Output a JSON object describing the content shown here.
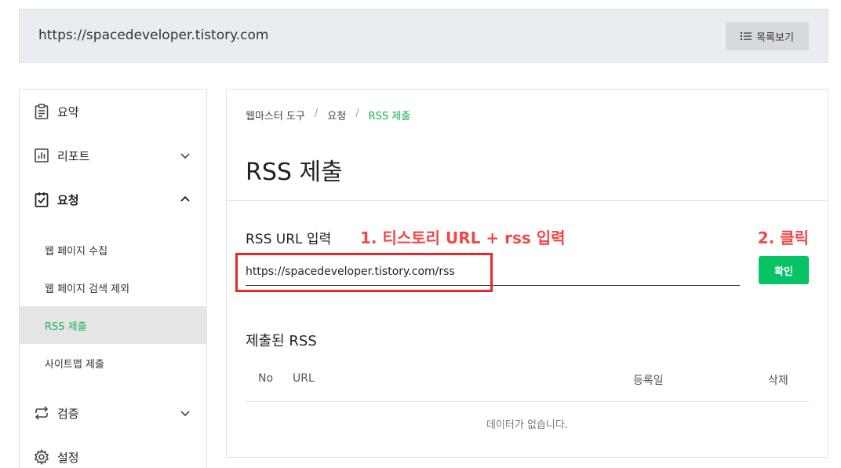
{
  "header": {
    "site_url": "https://spacedeveloper.tistory.com",
    "list_button_label": "목록보기",
    "list_button_icon": "list-icon"
  },
  "sidebar": {
    "items": [
      {
        "label": "요약",
        "icon": "clipboard-icon"
      },
      {
        "label": "리포트",
        "icon": "bar-chart-icon",
        "expanded": false
      },
      {
        "label": "요청",
        "icon": "checklist-icon",
        "expanded": true
      },
      {
        "label": "검증",
        "icon": "repeat-icon",
        "expanded": false
      },
      {
        "label": "설정",
        "icon": "gear-icon"
      }
    ],
    "sub_items": [
      {
        "label": "웹 페이지 수집"
      },
      {
        "label": "웹 페이지 검색 제외"
      },
      {
        "label": "RSS 제출",
        "active": true
      },
      {
        "label": "사이트맵 제출"
      }
    ]
  },
  "breadcrumb": {
    "items": [
      "웹마스터 도구",
      "요청",
      "RSS 제출"
    ],
    "separator": "/"
  },
  "page": {
    "title": "RSS 제출",
    "input_label": "RSS URL 입력",
    "input_value": "https://spacedeveloper.tistory.com/rss",
    "confirm_label": "확인",
    "submitted_title": "제출된 RSS",
    "empty_message": "데이터가 없습니다."
  },
  "table": {
    "columns": [
      "No",
      "URL",
      "등록일",
      "삭제"
    ]
  },
  "annotations": {
    "step1": "1. 티스토리 URL + rss 입력",
    "step2": "2. 클릭"
  },
  "colors": {
    "accent_green": "#18b353",
    "button_green": "#06c466",
    "annotation_red": "#f0494a",
    "highlight_box_red": "#e8282c"
  }
}
